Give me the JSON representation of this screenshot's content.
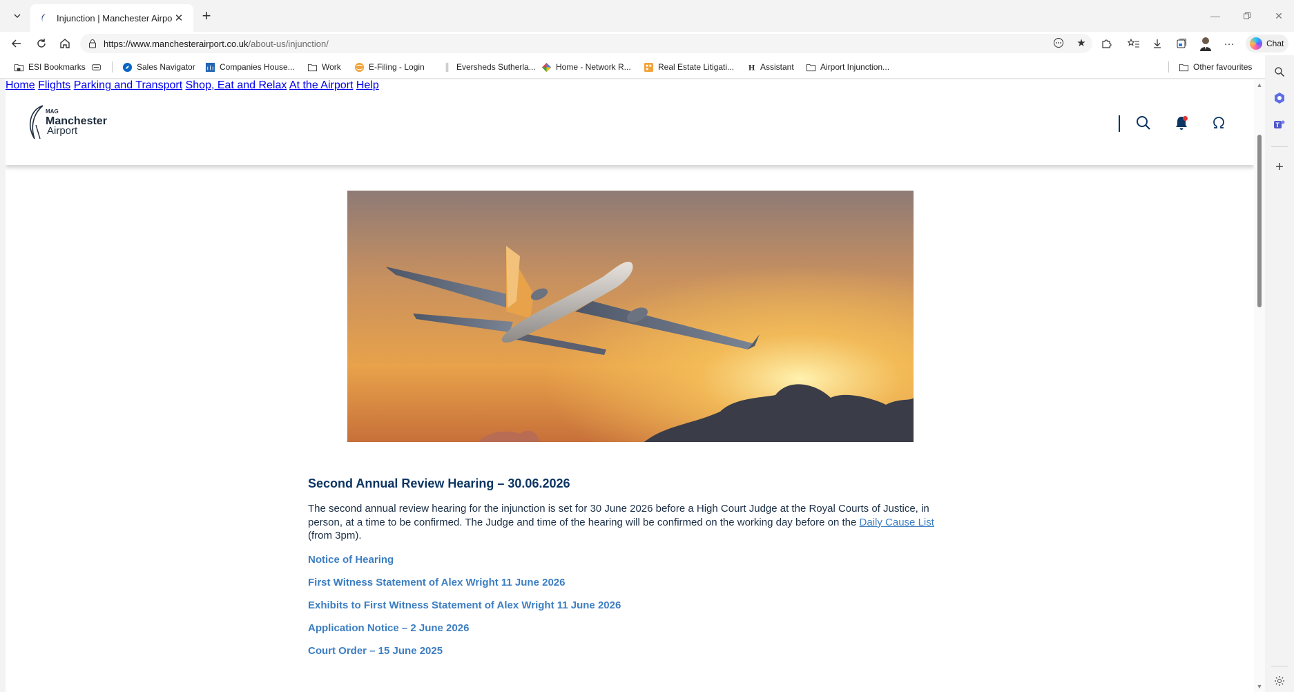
{
  "browser": {
    "tab": {
      "title": "Injunction | Manchester Airport"
    },
    "address": {
      "host": "https://www.manchesterairport.co.uk",
      "path": "/about-us/injunction/"
    },
    "chat_label": "Chat",
    "bookmarks": [
      {
        "label": "ESI Bookmarks",
        "icon": "folder-lock-icon"
      },
      {
        "label": "",
        "icon": "card-icon"
      },
      {
        "label": "Sales Navigator",
        "icon": "compass-icon"
      },
      {
        "label": "Companies House...",
        "icon": "building-icon"
      },
      {
        "label": "Work",
        "icon": "folder-icon"
      },
      {
        "label": "E-Filing - Login",
        "icon": "globe-icon"
      },
      {
        "label": "Eversheds Sutherla...",
        "icon": "page-icon"
      },
      {
        "label": "Home - Network R...",
        "icon": "network-icon"
      },
      {
        "label": "Real Estate Litigati...",
        "icon": "grid-icon"
      },
      {
        "label": "Assistant",
        "icon": "h-icon"
      },
      {
        "label": "Airport Injunction...",
        "icon": "folder-icon"
      }
    ],
    "other_favourites": "Other favourites"
  },
  "site": {
    "logo": {
      "mag": "MAG",
      "line1": "Manchester",
      "line2": "Airport"
    },
    "nav": [
      "Home",
      "Flights",
      "Parking and Transport",
      "Shop, Eat and Relax",
      "At the Airport",
      "Help"
    ]
  },
  "content": {
    "heading": "Second Annual Review Hearing – 30.06.2026",
    "paragraph_before": "The second annual review hearing for the injunction is set for 30 June 2026 before a High Court Judge at the Royal Courts of Justice, in person, at a time to be confirmed. The Judge and time of the hearing will be confirmed on the working day before on the ",
    "paragraph_link": "Daily Cause List",
    "paragraph_after": " (from 3pm).",
    "links": [
      "Notice of Hearing",
      "First Witness Statement of Alex Wright 11 June 2026",
      "Exhibits to First Witness Statement of Alex Wright 11 June 2026",
      "Application Notice – 2 June 2026",
      "Court Order – 15 June 2025"
    ]
  },
  "colors": {
    "brand_navy": "#0b3563",
    "link_blue": "#3c7ec2"
  }
}
